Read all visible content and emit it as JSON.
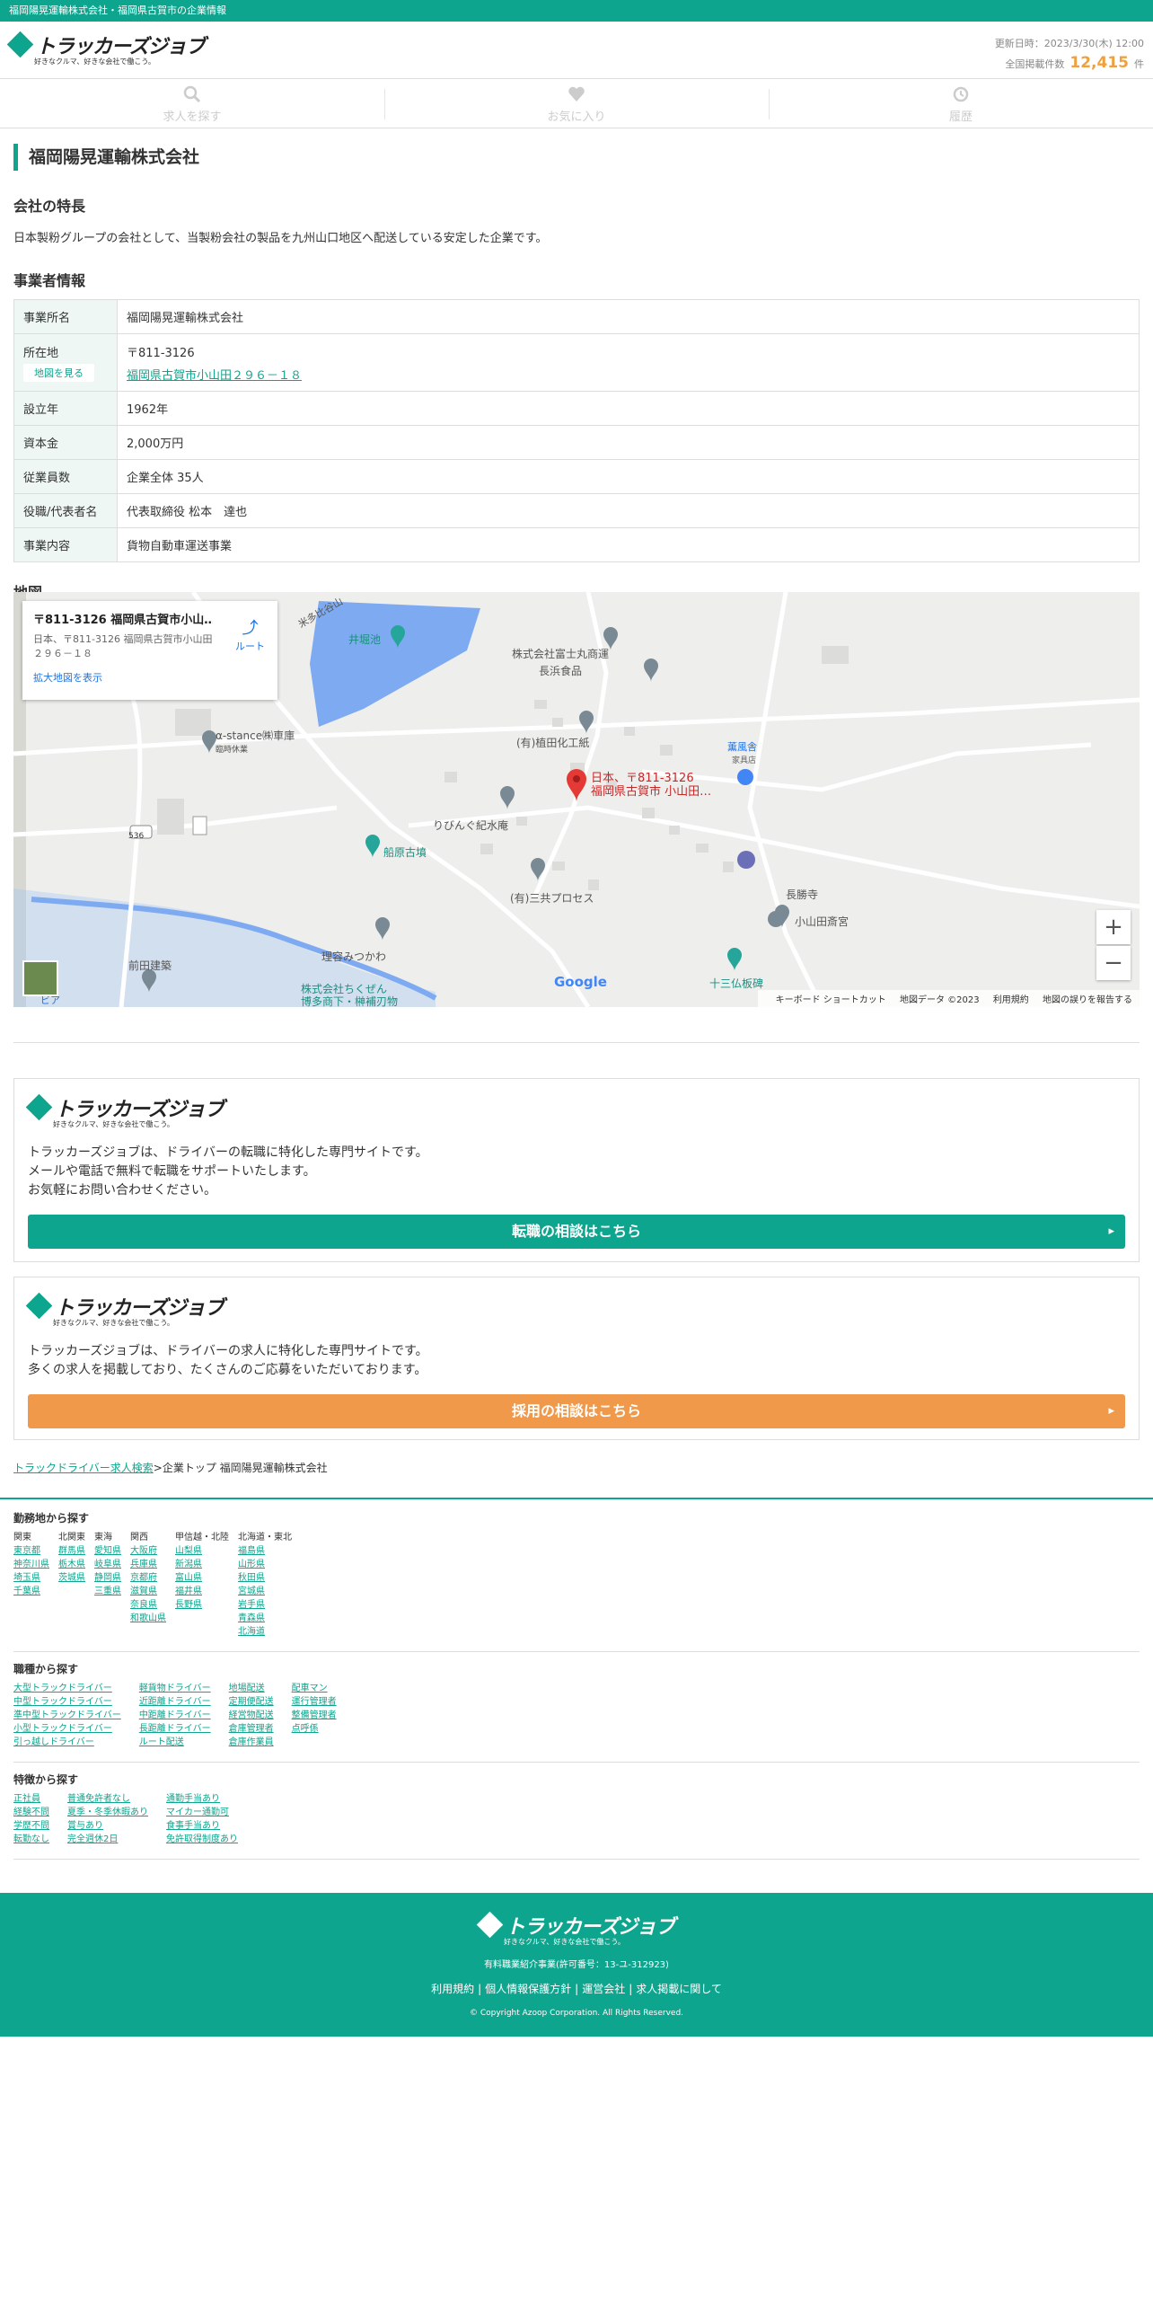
{
  "topbar": {
    "text": "福岡陽晃運輸株式会社・福岡県古賀市の企業情報"
  },
  "header": {
    "logo_text": "トラッカーズジョブ",
    "logo_tagline": "好きなクルマ、好きな会社で働こう。",
    "updated": "更新日時：2023/3/30(木) 12:00",
    "count_label": "全国掲載件数",
    "count": "12,415",
    "count_unit": "件"
  },
  "nav": {
    "search": "求人を探す",
    "favorites": "お気に入り",
    "history": "履歴"
  },
  "company": {
    "title": "福岡陽晃運輸株式会社",
    "features_heading": "会社の特長",
    "features_text": "日本製粉グループの会社として、当製粉会社の製品を九州山口地区へ配送している安定した企業です。",
    "info_heading": "事業者情報",
    "rows": [
      {
        "label": "事業所名",
        "value": "福岡陽晃運輸株式会社"
      },
      {
        "label": "所在地",
        "postal": "〒811-3126",
        "address": "福岡県古賀市小山田２９６－１８",
        "map_button": "地図を見る"
      },
      {
        "label": "設立年",
        "value": "1962年"
      },
      {
        "label": "資本金",
        "value": "2,000万円"
      },
      {
        "label": "従業員数",
        "value": "企業全体 35人"
      },
      {
        "label": "役職/代表者名",
        "value": "代表取締役 松本　達也"
      },
      {
        "label": "事業内容",
        "value": "貨物自動車運送事業"
      }
    ],
    "map_heading": "地図"
  },
  "map": {
    "card_title": "〒811-3126 福岡県古賀市小山…",
    "card_address": "日本、〒811-3126 福岡県古賀市小山田２９６－１８",
    "card_enlarge": "拡大地図を表示",
    "card_route": "ルート",
    "marker_label_1": "日本、〒811-3126",
    "marker_label_2": "福岡県古賀市 小山田…",
    "google": "Google",
    "footer": {
      "shortcut": "キーボード ショートカット",
      "data": "地図データ ©2023",
      "terms": "利用規約",
      "report": "地図の誤りを報告する"
    },
    "places": [
      {
        "name": "株式会社富士丸商運"
      },
      {
        "name": "長浜食品"
      },
      {
        "name": "(有)植田化工紙"
      },
      {
        "name": "α-stance㈱車庫"
      },
      {
        "name": "臨時休業"
      },
      {
        "name": "りびんぐ紀水庵"
      },
      {
        "name": "(有)三共プロセス"
      },
      {
        "name": "理容みつかわ"
      },
      {
        "name": "前田建築"
      },
      {
        "name": "株式会社ちくぜん"
      },
      {
        "name": "博多商下・榊補刃物"
      },
      {
        "name": "船原古墳"
      },
      {
        "name": "井堀池"
      },
      {
        "name": "長勝寺"
      },
      {
        "name": "小山田斎宮"
      },
      {
        "name": "十三仏板碑"
      },
      {
        "name": "薫風舎"
      },
      {
        "name": "家具店"
      },
      {
        "name": "536"
      },
      {
        "name": "米多比谷山"
      },
      {
        "name": "ビア"
      }
    ]
  },
  "promo_driver": {
    "text1": "トラッカーズジョブは、ドライバーの転職に特化した専門サイトです。",
    "text2": "メールや電話で無料で転職をサポートいたします。",
    "text3": "お気軽にお問い合わせください。",
    "cta": "転職の相談はこちら",
    "cta_color": "#0da58e"
  },
  "promo_hiring": {
    "text1": "トラッカーズジョブは、ドライバーの求人に特化した専門サイトです。",
    "text2": "多くの求人を掲載しており、たくさんのご応募をいただいております。",
    "cta": "採用の相談はこちら",
    "cta_color": "#f0994a"
  },
  "breadcrumb": {
    "link": "トラックドライバー求人検索",
    "sep": ">企業トップ",
    "current": "福岡陽晃運輸株式会社"
  },
  "footnav": {
    "area_heading": "勤務地から探す",
    "area_cols": [
      {
        "head": "関東",
        "items": [
          "東京都",
          "神奈川県",
          "埼玉県",
          "千葉県"
        ]
      },
      {
        "head": "北関東",
        "items": [
          "群馬県",
          "栃木県",
          "茨城県"
        ]
      },
      {
        "head": "東海",
        "items": [
          "愛知県",
          "岐阜県",
          "静岡県",
          "三重県"
        ]
      },
      {
        "head": "関西",
        "items": [
          "大阪府",
          "兵庫県",
          "京都府",
          "滋賀県",
          "奈良県",
          "和歌山県"
        ]
      },
      {
        "head": "甲信越・北陸",
        "items": [
          "山梨県",
          "新潟県",
          "富山県",
          "福井県",
          "長野県"
        ]
      },
      {
        "head": "北海道・東北",
        "items": [
          "福島県",
          "山形県",
          "秋田県",
          "宮城県",
          "岩手県",
          "青森県",
          "北海道"
        ]
      }
    ],
    "job_heading": "職種から探す",
    "job_cols": [
      {
        "items": [
          "大型トラックドライバー",
          "中型トラックドライバー",
          "準中型トラックドライバー",
          "小型トラックドライバー",
          "引っ越しドライバー"
        ]
      },
      {
        "items": [
          "軽貨物ドライバー",
          "近距離ドライバー",
          "中距離ドライバー",
          "長距離ドライバー",
          "ルート配送"
        ]
      },
      {
        "items": [
          "地場配送",
          "定期便配送",
          "経営物配送",
          "倉庫管理者",
          "倉庫作業員"
        ]
      },
      {
        "items": [
          "配車マン",
          "運行管理者",
          "整備管理者",
          "点呼係"
        ]
      }
    ],
    "feature_heading": "特徴から探す",
    "feature_cols": [
      {
        "items": [
          "正社員",
          "経験不問",
          "学歴不問",
          "転勤なし"
        ]
      },
      {
        "items": [
          "普通免許者なし",
          "夏季・冬季休暇あり",
          "賞与あり",
          "完全週休2日"
        ]
      },
      {
        "items": [
          "通勤手当あり",
          "マイカー通勤可",
          "食事手当あり",
          "免許取得制度あり"
        ]
      }
    ]
  },
  "footer": {
    "license": "有料職業紹介事業(許可番号：13-ユ-312923)",
    "links": [
      "利用規約",
      "個人情報保護方針",
      "運営会社",
      "求人掲載に関して"
    ],
    "copyright": "© Copyright Azoop Corporation. All Rights Reserved."
  }
}
